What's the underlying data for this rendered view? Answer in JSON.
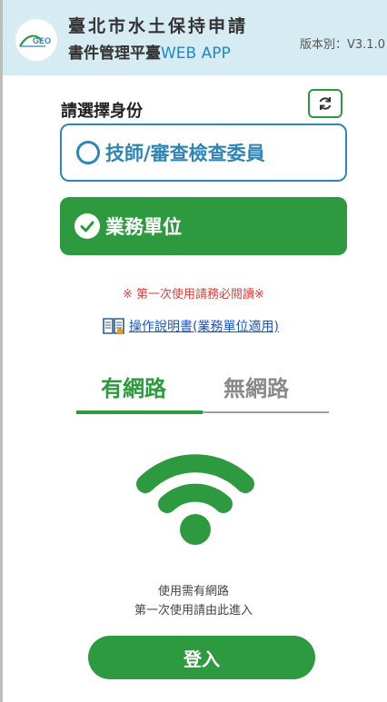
{
  "header": {
    "logo_text": "GEO",
    "title_line1": "臺北市水土保持申請",
    "title_line2_prefix": "書件管理平臺",
    "title_line2_accent": "WEB APP",
    "version": "版本別：V3.1.0"
  },
  "identity": {
    "label": "請選擇身份",
    "refresh_icon": "refresh-icon",
    "options": [
      {
        "label": "技師/審查檢查委員",
        "selected": false
      },
      {
        "label": "業務單位",
        "selected": true
      }
    ]
  },
  "notice": "※ 第一次使用請務必閱讀※",
  "manual": {
    "icon": "book-icon",
    "link_text": "操作說明書(業務單位適用)"
  },
  "tabs": [
    {
      "label": "有網路",
      "active": true
    },
    {
      "label": "無網路",
      "active": false
    }
  ],
  "network": {
    "icon": "wifi-icon",
    "desc_line1": "使用需有網路",
    "desc_line2": "第一次使用請由此進入",
    "login_label": "登入"
  },
  "colors": {
    "brand_green": "#2e9a3f",
    "tech_blue": "#2e86b6",
    "header_bg": "#d6ebf2",
    "notice_red": "#e53935",
    "link_blue": "#1a55c5"
  }
}
